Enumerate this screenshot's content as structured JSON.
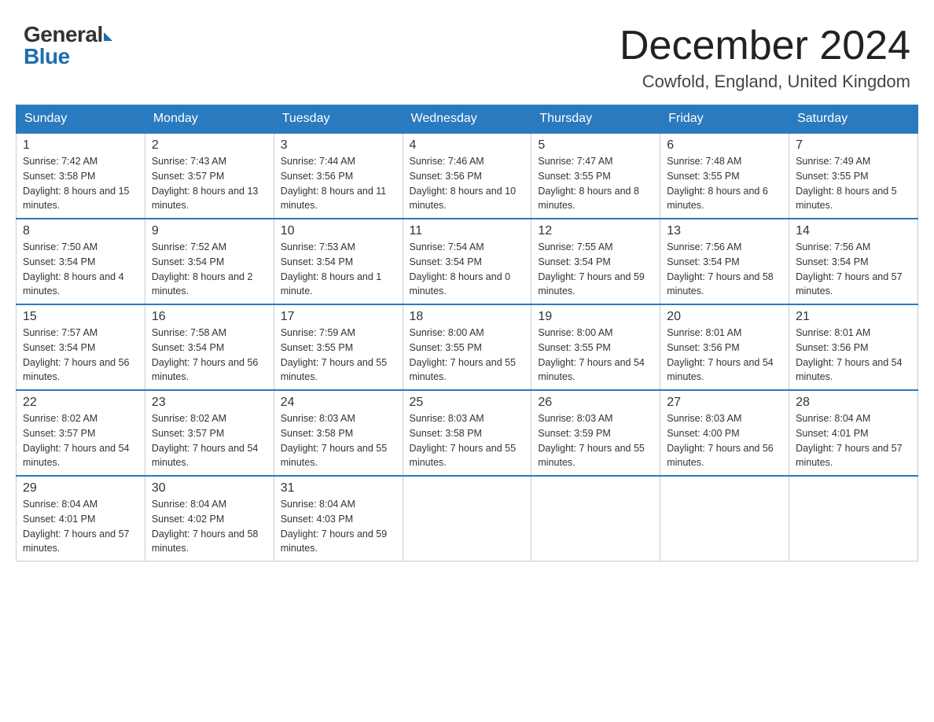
{
  "header": {
    "logo_general": "General",
    "logo_blue": "Blue",
    "month_title": "December 2024",
    "location": "Cowfold, England, United Kingdom"
  },
  "days_of_week": [
    "Sunday",
    "Monday",
    "Tuesday",
    "Wednesday",
    "Thursday",
    "Friday",
    "Saturday"
  ],
  "weeks": [
    [
      {
        "day": "1",
        "sunrise": "7:42 AM",
        "sunset": "3:58 PM",
        "daylight": "8 hours and 15 minutes."
      },
      {
        "day": "2",
        "sunrise": "7:43 AM",
        "sunset": "3:57 PM",
        "daylight": "8 hours and 13 minutes."
      },
      {
        "day": "3",
        "sunrise": "7:44 AM",
        "sunset": "3:56 PM",
        "daylight": "8 hours and 11 minutes."
      },
      {
        "day": "4",
        "sunrise": "7:46 AM",
        "sunset": "3:56 PM",
        "daylight": "8 hours and 10 minutes."
      },
      {
        "day": "5",
        "sunrise": "7:47 AM",
        "sunset": "3:55 PM",
        "daylight": "8 hours and 8 minutes."
      },
      {
        "day": "6",
        "sunrise": "7:48 AM",
        "sunset": "3:55 PM",
        "daylight": "8 hours and 6 minutes."
      },
      {
        "day": "7",
        "sunrise": "7:49 AM",
        "sunset": "3:55 PM",
        "daylight": "8 hours and 5 minutes."
      }
    ],
    [
      {
        "day": "8",
        "sunrise": "7:50 AM",
        "sunset": "3:54 PM",
        "daylight": "8 hours and 4 minutes."
      },
      {
        "day": "9",
        "sunrise": "7:52 AM",
        "sunset": "3:54 PM",
        "daylight": "8 hours and 2 minutes."
      },
      {
        "day": "10",
        "sunrise": "7:53 AM",
        "sunset": "3:54 PM",
        "daylight": "8 hours and 1 minute."
      },
      {
        "day": "11",
        "sunrise": "7:54 AM",
        "sunset": "3:54 PM",
        "daylight": "8 hours and 0 minutes."
      },
      {
        "day": "12",
        "sunrise": "7:55 AM",
        "sunset": "3:54 PM",
        "daylight": "7 hours and 59 minutes."
      },
      {
        "day": "13",
        "sunrise": "7:56 AM",
        "sunset": "3:54 PM",
        "daylight": "7 hours and 58 minutes."
      },
      {
        "day": "14",
        "sunrise": "7:56 AM",
        "sunset": "3:54 PM",
        "daylight": "7 hours and 57 minutes."
      }
    ],
    [
      {
        "day": "15",
        "sunrise": "7:57 AM",
        "sunset": "3:54 PM",
        "daylight": "7 hours and 56 minutes."
      },
      {
        "day": "16",
        "sunrise": "7:58 AM",
        "sunset": "3:54 PM",
        "daylight": "7 hours and 56 minutes."
      },
      {
        "day": "17",
        "sunrise": "7:59 AM",
        "sunset": "3:55 PM",
        "daylight": "7 hours and 55 minutes."
      },
      {
        "day": "18",
        "sunrise": "8:00 AM",
        "sunset": "3:55 PM",
        "daylight": "7 hours and 55 minutes."
      },
      {
        "day": "19",
        "sunrise": "8:00 AM",
        "sunset": "3:55 PM",
        "daylight": "7 hours and 54 minutes."
      },
      {
        "day": "20",
        "sunrise": "8:01 AM",
        "sunset": "3:56 PM",
        "daylight": "7 hours and 54 minutes."
      },
      {
        "day": "21",
        "sunrise": "8:01 AM",
        "sunset": "3:56 PM",
        "daylight": "7 hours and 54 minutes."
      }
    ],
    [
      {
        "day": "22",
        "sunrise": "8:02 AM",
        "sunset": "3:57 PM",
        "daylight": "7 hours and 54 minutes."
      },
      {
        "day": "23",
        "sunrise": "8:02 AM",
        "sunset": "3:57 PM",
        "daylight": "7 hours and 54 minutes."
      },
      {
        "day": "24",
        "sunrise": "8:03 AM",
        "sunset": "3:58 PM",
        "daylight": "7 hours and 55 minutes."
      },
      {
        "day": "25",
        "sunrise": "8:03 AM",
        "sunset": "3:58 PM",
        "daylight": "7 hours and 55 minutes."
      },
      {
        "day": "26",
        "sunrise": "8:03 AM",
        "sunset": "3:59 PM",
        "daylight": "7 hours and 55 minutes."
      },
      {
        "day": "27",
        "sunrise": "8:03 AM",
        "sunset": "4:00 PM",
        "daylight": "7 hours and 56 minutes."
      },
      {
        "day": "28",
        "sunrise": "8:04 AM",
        "sunset": "4:01 PM",
        "daylight": "7 hours and 57 minutes."
      }
    ],
    [
      {
        "day": "29",
        "sunrise": "8:04 AM",
        "sunset": "4:01 PM",
        "daylight": "7 hours and 57 minutes."
      },
      {
        "day": "30",
        "sunrise": "8:04 AM",
        "sunset": "4:02 PM",
        "daylight": "7 hours and 58 minutes."
      },
      {
        "day": "31",
        "sunrise": "8:04 AM",
        "sunset": "4:03 PM",
        "daylight": "7 hours and 59 minutes."
      },
      null,
      null,
      null,
      null
    ]
  ],
  "labels": {
    "sunrise_prefix": "Sunrise: ",
    "sunset_prefix": "Sunset: ",
    "daylight_prefix": "Daylight: "
  }
}
